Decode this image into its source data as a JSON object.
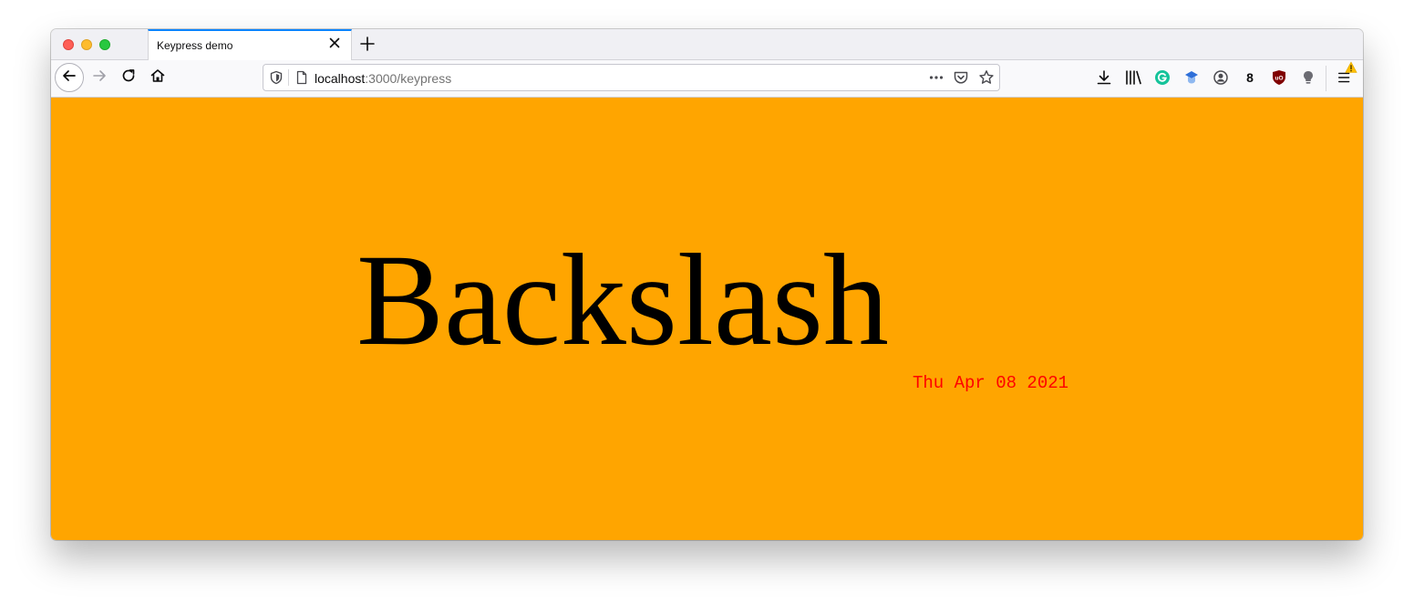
{
  "browser": {
    "tab": {
      "title": "Keypress demo"
    },
    "address_bar": {
      "host": "localhost",
      "path": ":3000/keypress"
    },
    "toolbar": {
      "extension_badge_count": "8"
    },
    "colors": {
      "tab_accent": "#0a84ff",
      "grammarly": "#15c39a",
      "ublock": "#800000",
      "warning": "#ffbf00"
    },
    "icons": [
      "close-icon",
      "plus-icon",
      "back-arrow-icon",
      "forward-arrow-icon",
      "reload-icon",
      "home-icon",
      "shield-icon",
      "page-icon",
      "more-icon",
      "pocket-icon",
      "star-icon",
      "download-icon",
      "library-icon",
      "grammarly-icon",
      "extension-icon",
      "account-icon",
      "ublock-icon",
      "lightbulb-icon",
      "hamburger-menu-icon",
      "warning-icon"
    ]
  },
  "page": {
    "key_name": "Backslash",
    "date": "Thu Apr 08 2021",
    "colors": {
      "background": "#ffa500",
      "key_text": "#000000",
      "date_text": "#ff0000"
    }
  }
}
